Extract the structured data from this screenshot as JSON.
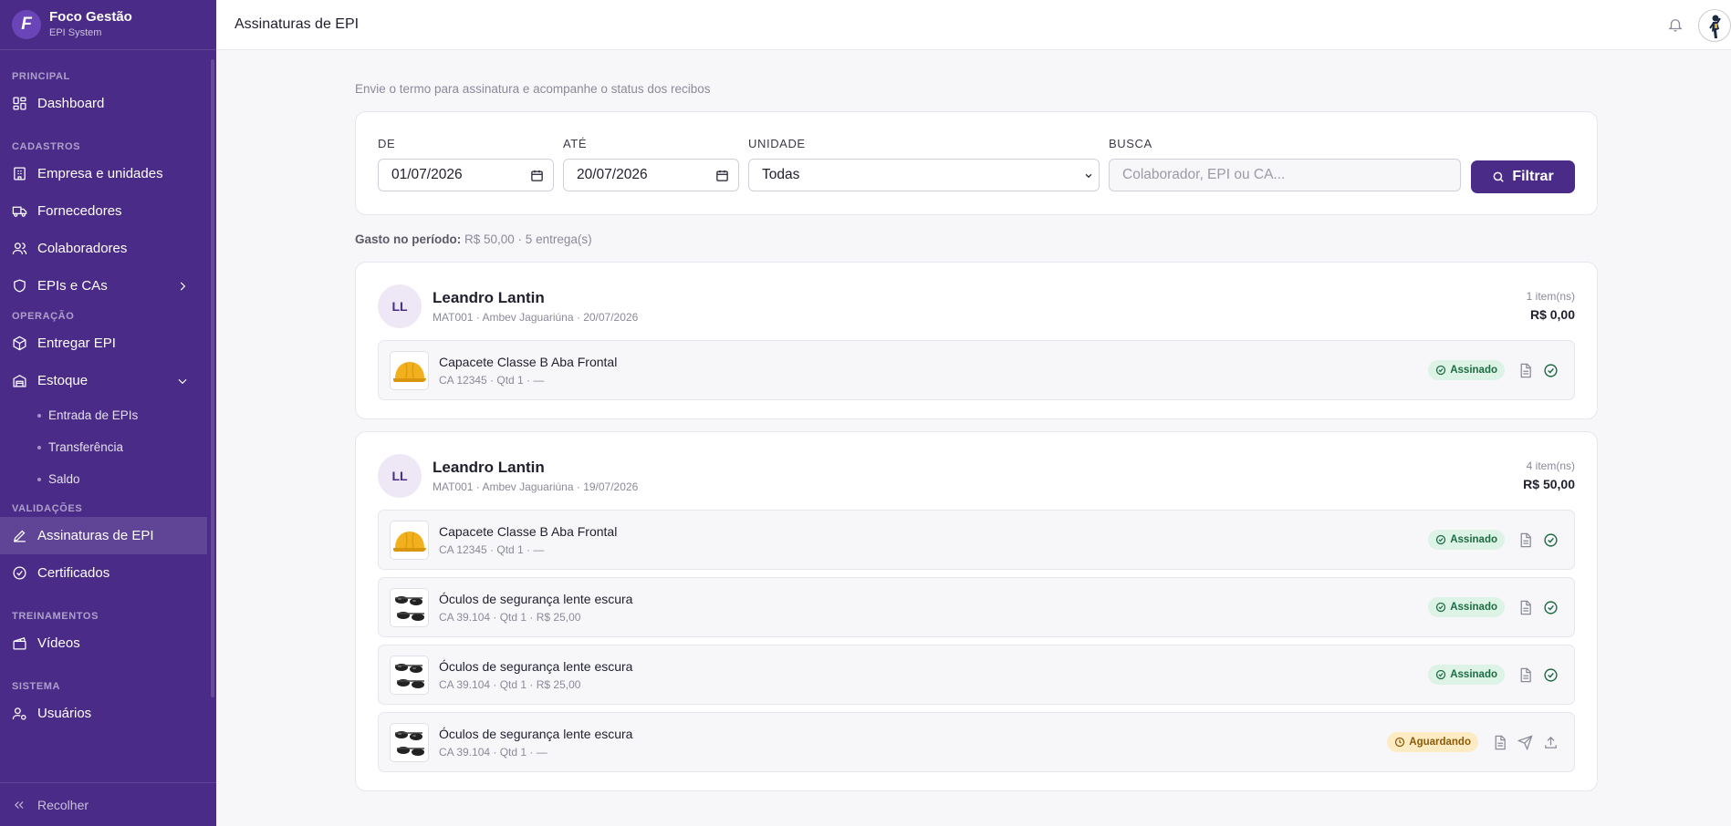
{
  "brand": {
    "name": "Foco Gestão",
    "subtitle": "EPI System",
    "logo_letter": "F"
  },
  "sidebar": {
    "sections": [
      {
        "title": "PRINCIPAL"
      },
      {
        "title": "CADASTROS"
      },
      {
        "title": "OPERAÇÃO"
      },
      {
        "title": "VALIDAÇÕES"
      },
      {
        "title": "TREINAMENTOS"
      },
      {
        "title": "SISTEMA"
      }
    ],
    "items": {
      "dashboard": "Dashboard",
      "empresa": "Empresa e unidades",
      "fornecedores": "Fornecedores",
      "colaboradores": "Colaboradores",
      "epis": "EPIs e CAs",
      "entregar": "Entregar EPI",
      "estoque": "Estoque",
      "entrada": "Entrada de EPIs",
      "transferencia": "Transferência",
      "saldo": "Saldo",
      "assinaturas": "Assinaturas de EPI",
      "certificados": "Certificados",
      "videos": "Vídeos",
      "usuarios": "Usuários"
    },
    "collapse_label": "Recolher"
  },
  "header": {
    "title": "Assinaturas de EPI"
  },
  "page": {
    "subtitle": "Envie o termo para assinatura e acompanhe o status dos recibos",
    "filters": {
      "de_label": "DE",
      "de_value": "01/07/2026",
      "ate_label": "ATÉ",
      "ate_value": "20/07/2026",
      "unidade_label": "UNIDADE",
      "unidade_value": "Todas",
      "busca_label": "BUSCA",
      "busca_placeholder": "Colaborador, EPI ou CA...",
      "button": "Filtrar"
    },
    "summary_label": "Gasto no período:",
    "summary_value": "R$ 50,00 · 5 entrega(s)"
  },
  "entregas": [
    {
      "initials": "LL",
      "name": "Leandro Lantin",
      "meta": "MAT001 · Ambev Jaguariúna · 20/07/2026",
      "count": "1 item(ns)",
      "total": "R$ 0,00",
      "items": [
        {
          "name": "Capacete Classe B Aba Frontal",
          "meta": "CA 12345 · Qtd 1 · —",
          "status": "Assinado",
          "thumb": "helmet"
        }
      ]
    },
    {
      "initials": "LL",
      "name": "Leandro Lantin",
      "meta": "MAT001 · Ambev Jaguariúna · 19/07/2026",
      "count": "4 item(ns)",
      "total": "R$ 50,00",
      "items": [
        {
          "name": "Capacete Classe B Aba Frontal",
          "meta": "CA 12345 · Qtd 1 · —",
          "status": "Assinado",
          "thumb": "helmet"
        },
        {
          "name": "Óculos de segurança lente escura",
          "meta": "CA 39.104 · Qtd 1 · R$ 25,00",
          "status": "Assinado",
          "thumb": "glasses"
        },
        {
          "name": "Óculos de segurança lente escura",
          "meta": "CA 39.104 · Qtd 1 · R$ 25,00",
          "status": "Assinado",
          "thumb": "glasses"
        },
        {
          "name": "Óculos de segurança lente escura",
          "meta": "CA 39.104 · Qtd 1 · —",
          "status": "Aguardando",
          "thumb": "glasses"
        }
      ]
    }
  ],
  "colors": {
    "sidebar": "#4a2b87",
    "accent": "#4a2b87",
    "ok_bg": "#dcf3e6",
    "ok_fg": "#1d6b43",
    "wait_bg": "#fdebc3",
    "wait_fg": "#8a5a08"
  }
}
